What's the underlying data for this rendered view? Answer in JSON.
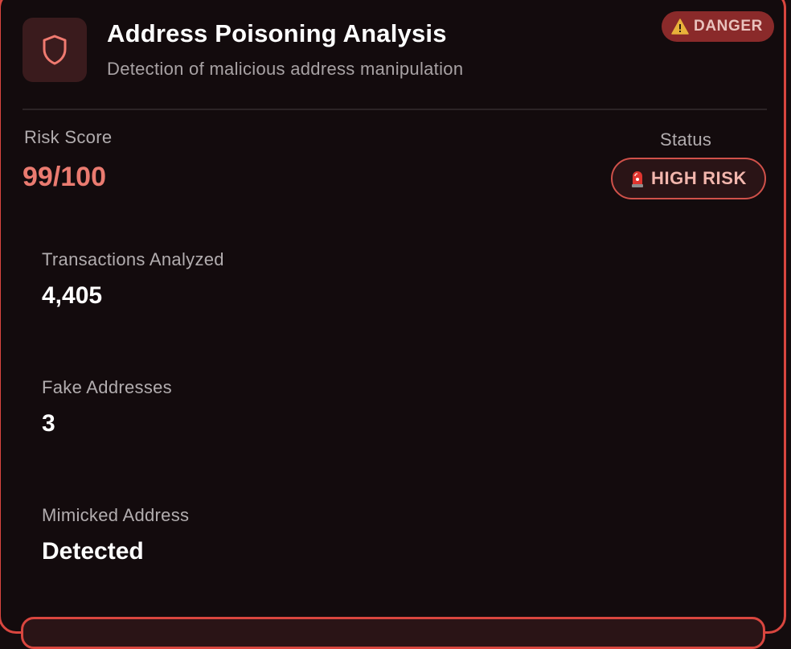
{
  "header": {
    "title": "Address Poisoning Analysis",
    "subtitle": "Detection of malicious address manipulation",
    "badge": {
      "icon": "warning-icon",
      "label": "DANGER"
    }
  },
  "risk": {
    "label": "Risk Score",
    "value": "99/100"
  },
  "status": {
    "label": "Status",
    "icon": "alarm-icon",
    "value": "HIGH RISK"
  },
  "stats": [
    {
      "label": "Transactions Analyzed",
      "value": "4,405"
    },
    {
      "label": "Fake Addresses",
      "value": "3"
    },
    {
      "label": "Mimicked Address",
      "value": "Detected"
    }
  ],
  "colors": {
    "accent": "#d9463f",
    "risk_value": "#ea7b70",
    "background": "#130b0d"
  }
}
